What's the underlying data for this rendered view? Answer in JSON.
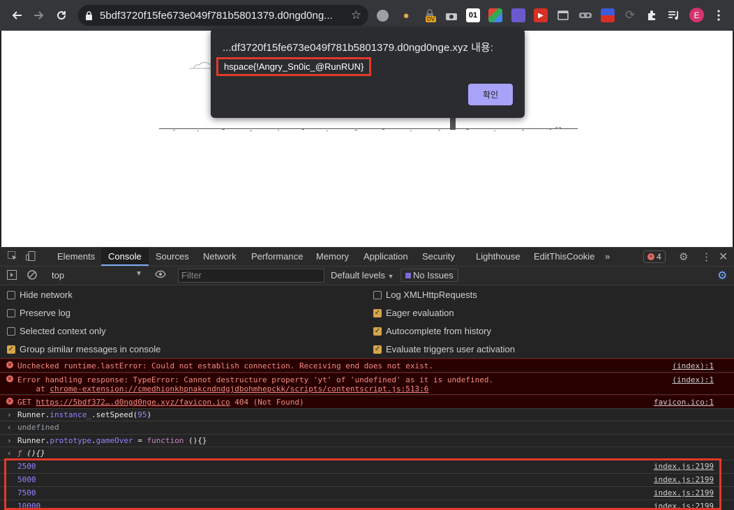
{
  "browser": {
    "url": "5bdf3720f15fe673e049f781b5801379.d0ngd0ng...",
    "extensions": [
      "circle-ext",
      "cookie-ext",
      "dv-ext",
      "camera-ext",
      "01-ext",
      "google-ext",
      "purple-ext",
      "red-ext",
      "window-ext",
      "glasses-ext",
      "flag-ext",
      "refresh-ext",
      "puzzle-icon",
      "media-icon"
    ],
    "ext_dv_label": "DV",
    "ext_01_label": "01",
    "profile_initial": "E"
  },
  "alert": {
    "origin": "...df3720f15fe673e049f781b5801379.d0ngd0nge.xyz 내용:",
    "message": "hspace{!Angry_Sn0ic_@RunRUN}",
    "ok_label": "확인"
  },
  "devtools": {
    "tabs": [
      "Elements",
      "Console",
      "Sources",
      "Network",
      "Performance",
      "Memory",
      "Application",
      "Security",
      "Lighthouse",
      "EditThisCookie"
    ],
    "more_tabs": "»",
    "active_tab": "Console",
    "error_count": "4",
    "context": "top",
    "filter_placeholder": "Filter",
    "levels": "Default levels",
    "issues": "No Issues",
    "settings_left": [
      {
        "label": "Hide network",
        "checked": false
      },
      {
        "label": "Preserve log",
        "checked": false
      },
      {
        "label": "Selected context only",
        "checked": false
      },
      {
        "label": "Group similar messages in console",
        "checked": true
      }
    ],
    "settings_right": [
      {
        "label": "Log XMLHttpRequests",
        "checked": false
      },
      {
        "label": "Eager evaluation",
        "checked": true
      },
      {
        "label": "Autocomplete from history",
        "checked": true
      },
      {
        "label": "Evaluate triggers user activation",
        "checked": true
      }
    ]
  },
  "console": {
    "errors": [
      {
        "text": "Unchecked runtime.lastError: Could not establish connection. Receiving end does not exist.",
        "source": "(index):1"
      },
      {
        "text": "Error handling response: TypeError: Cannot destructure property 'yt' of 'undefined' as it is undefined.",
        "text2_prefix": "    at ",
        "text2_link": "chrome-extension://cmedhionkhpnakcndndgjdbohmhepckk/scripts/contentscript.js:513:6",
        "source": "(index):1"
      },
      {
        "text_prefix": "GET ",
        "text_link": "https://5bdf372….d0ngd0nge.xyz/favicon.ico",
        "text_suffix": " 404 (Not Found)",
        "source": "favicon.ico:1"
      }
    ],
    "cmd1_obj": "Runner.",
    "cmd1_prop": "instance_",
    "cmd1_rest": ".setSpeed(",
    "cmd1_arg": "95",
    "cmd1_end": ")",
    "result1": "undefined",
    "cmd2_obj": "Runner.",
    "cmd2_prop": "prototype",
    "cmd2_mid": ".",
    "cmd2_prop2": "gameOver",
    "cmd2_eq": " = ",
    "cmd2_kw": "function",
    "cmd2_end": " (){}",
    "result2_f": "ƒ",
    "result2_body": " (){}",
    "logs": [
      {
        "value": "2500",
        "source": "index.js:2199"
      },
      {
        "value": "5000",
        "source": "index.js:2199"
      },
      {
        "value": "7500",
        "source": "index.js:2199"
      },
      {
        "value": "10000",
        "source": "index.js:2199"
      }
    ]
  }
}
